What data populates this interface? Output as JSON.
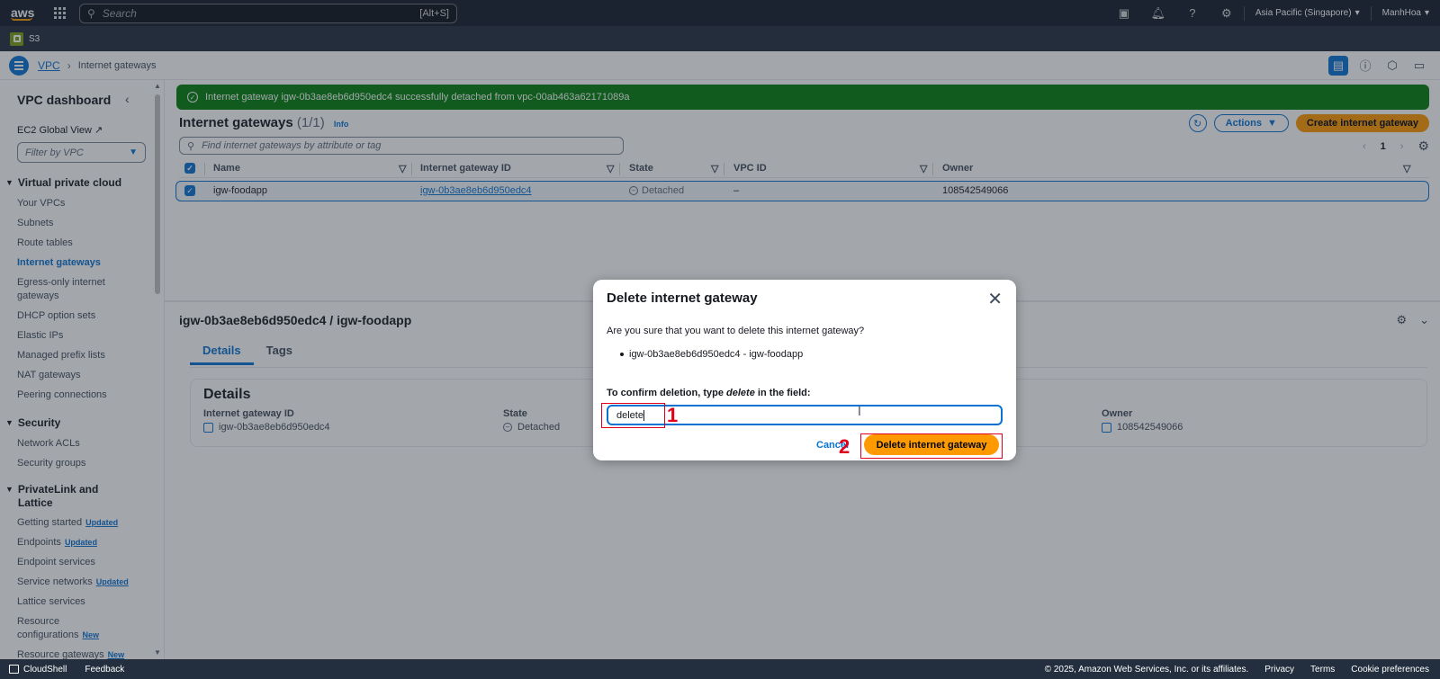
{
  "topbar": {
    "logo": "aws",
    "search_placeholder": "Search",
    "search_shortcut": "[Alt+S]",
    "region": "Asia Pacific (Singapore)",
    "user": "ManhHoa"
  },
  "servicebar": {
    "service": "S3"
  },
  "breadcrumb": {
    "root": "VPC",
    "current": "Internet gateways"
  },
  "sidebar": {
    "title": "VPC dashboard",
    "ec2_link": "EC2 Global View",
    "filter_placeholder": "Filter by VPC",
    "sections": {
      "vpc": "Virtual private cloud",
      "security": "Security",
      "privatelink": "PrivateLink and Lattice"
    },
    "vpc_items": [
      "Your VPCs",
      "Subnets",
      "Route tables",
      "Internet gateways",
      "Egress-only internet gateways",
      "DHCP option sets",
      "Elastic IPs",
      "Managed prefix lists",
      "NAT gateways",
      "Peering connections"
    ],
    "security_items": [
      "Network ACLs",
      "Security groups"
    ],
    "privatelink_items": [
      {
        "label": "Getting started",
        "badge": "Updated"
      },
      {
        "label": "Endpoints",
        "badge": "Updated"
      },
      {
        "label": "Endpoint services",
        "badge": ""
      },
      {
        "label": "Service networks",
        "badge": "Updated"
      },
      {
        "label": "Lattice services",
        "badge": ""
      },
      {
        "label": "Resource configurations",
        "badge": "New"
      },
      {
        "label": "Resource gateways",
        "badge": "New"
      }
    ]
  },
  "flash": {
    "message": "Internet gateway igw-0b3ae8eb6d950edc4 successfully detached from vpc-00ab463a62171089a"
  },
  "list": {
    "title": "Internet gateways",
    "count": "(1/1)",
    "info": "Info",
    "actions": "Actions",
    "create": "Create internet gateway",
    "find_placeholder": "Find internet gateways by attribute or tag",
    "page": "1",
    "columns": [
      "Name",
      "Internet gateway ID",
      "State",
      "VPC ID",
      "Owner"
    ],
    "rows": [
      {
        "name": "igw-foodapp",
        "id": "igw-0b3ae8eb6d950edc4",
        "state": "Detached",
        "vpc": "–",
        "owner": "108542549066"
      }
    ]
  },
  "detail": {
    "title": "igw-0b3ae8eb6d950edc4 / igw-foodapp",
    "tabs": [
      "Details",
      "Tags"
    ],
    "section": "Details",
    "fields": {
      "id_label": "Internet gateway ID",
      "id_value": "igw-0b3ae8eb6d950edc4",
      "state_label": "State",
      "state_value": "Detached",
      "owner_label": "Owner",
      "owner_value": "108542549066"
    }
  },
  "modal": {
    "title": "Delete internet gateway",
    "question": "Are you sure that you want to delete this internet gateway?",
    "item": "igw-0b3ae8eb6d950edc4 - igw-foodapp",
    "confirm_prefix": "To confirm deletion, type ",
    "confirm_word": "delete",
    "confirm_suffix": " in the field:",
    "input_value": "delete",
    "cancel": "Cancel",
    "delete": "Delete internet gateway"
  },
  "annotations": {
    "step1": "1",
    "step2": "2"
  },
  "footer": {
    "cloudshell": "CloudShell",
    "feedback": "Feedback",
    "copyright": "© 2025, Amazon Web Services, Inc. or its affiliates.",
    "privacy": "Privacy",
    "terms": "Terms",
    "cookies": "Cookie preferences"
  }
}
